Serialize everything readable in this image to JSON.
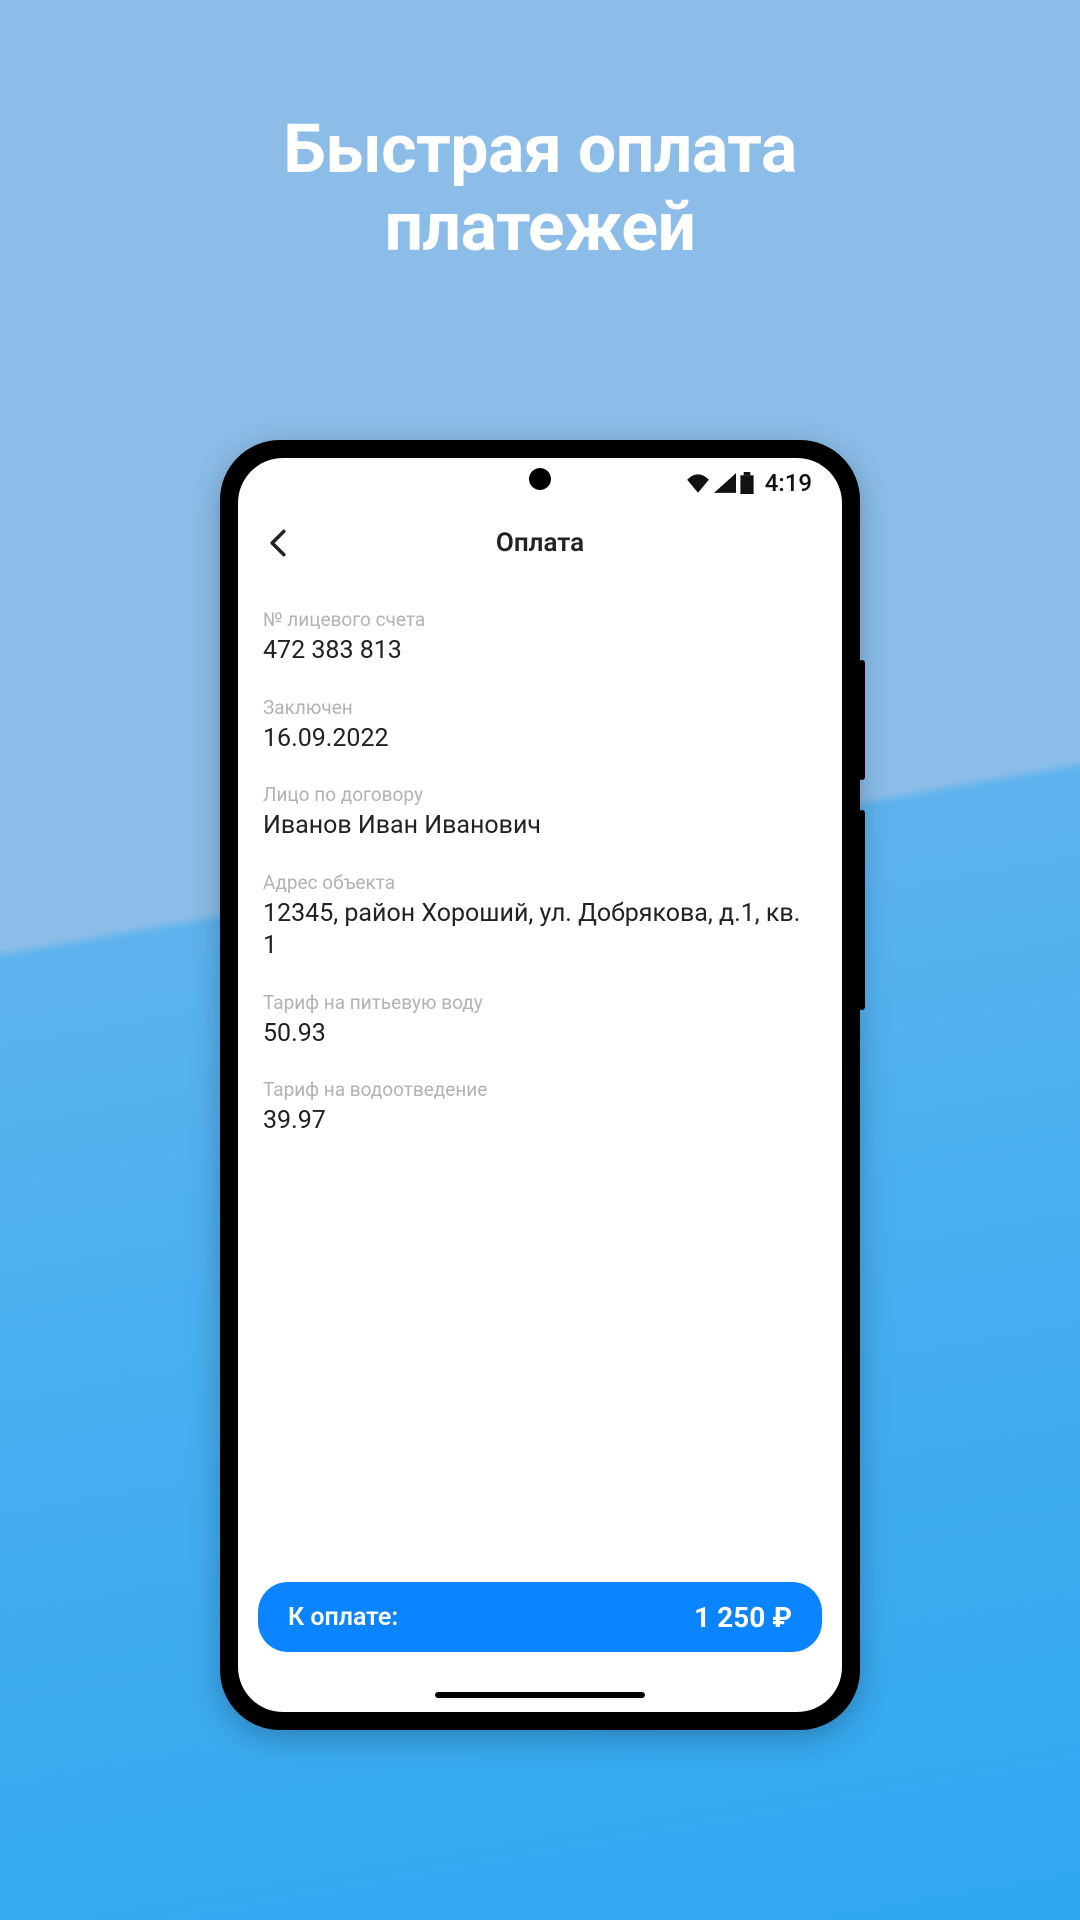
{
  "hero": {
    "line1": "Быстрая оплата",
    "line2": "платежей"
  },
  "statusbar": {
    "time": "4:19"
  },
  "header": {
    "title": "Оплата"
  },
  "fields": {
    "account": {
      "label": "№ лицевого счета",
      "value": "472 383 813"
    },
    "concluded": {
      "label": "Заключен",
      "value": "16.09.2022"
    },
    "person": {
      "label": "Лицо по договору",
      "value": "Иванов Иван Иванович"
    },
    "address": {
      "label": "Адрес объекта",
      "value": "12345, район Хороший, ул. Добрякова, д.1, кв. 1"
    },
    "tariff_water": {
      "label": "Тариф на питьевую воду",
      "value": "50.93"
    },
    "tariff_drain": {
      "label": "Тариф на водоотведение",
      "value": "39.97"
    }
  },
  "footer": {
    "pay_label": "К оплате:",
    "pay_amount": "1 250 ₽"
  }
}
